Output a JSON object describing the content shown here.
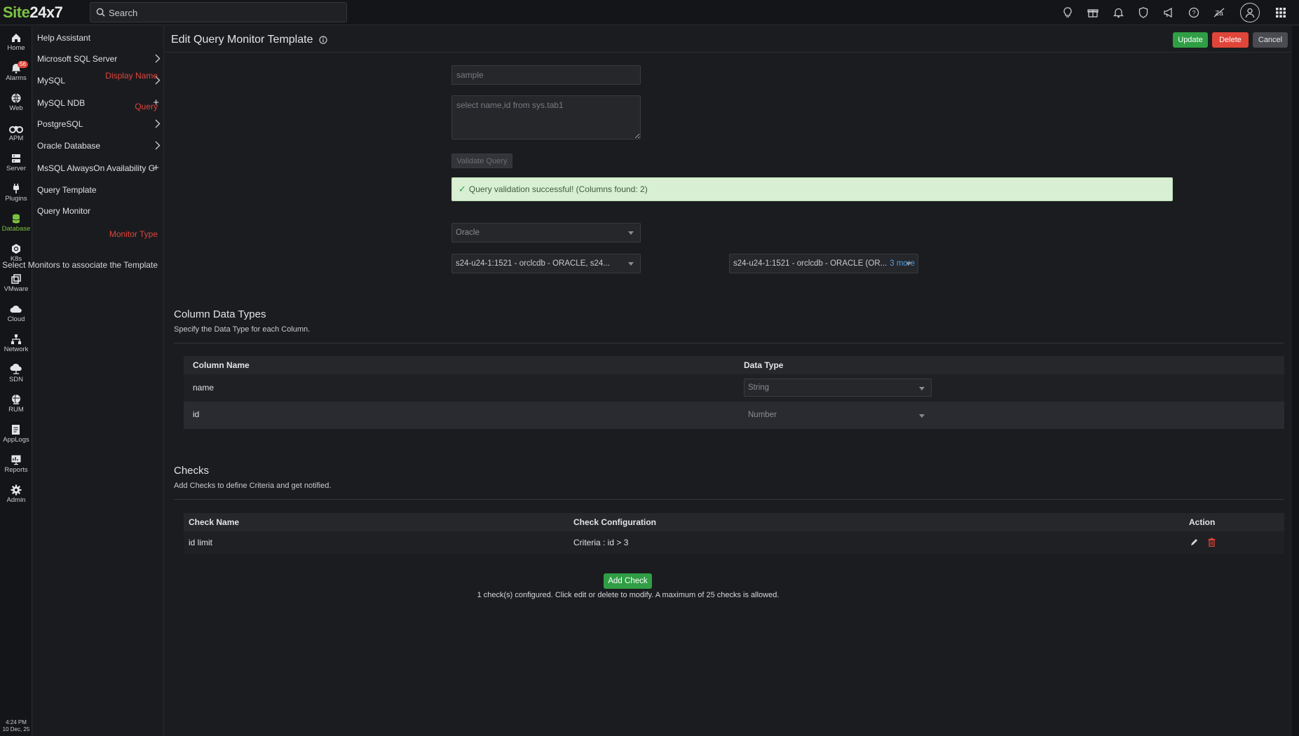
{
  "app": {
    "logo_site": "Site",
    "logo_num": "24x7",
    "search_placeholder": "Search",
    "top_icons": [
      "bulb-icon",
      "gift-icon",
      "bell-icon",
      "shield-icon",
      "megaphone-icon",
      "help-icon",
      "accessibility-icon",
      "user-avatar-icon",
      "apps-grid-icon"
    ]
  },
  "rail": {
    "items": [
      {
        "label": "Home",
        "icon": "home-icon"
      },
      {
        "label": "Alarms",
        "icon": "bell-icon",
        "badge": "56"
      },
      {
        "label": "Web",
        "icon": "globe-icon"
      },
      {
        "label": "APM",
        "icon": "binoculars-icon"
      },
      {
        "label": "Server",
        "icon": "server-icon"
      },
      {
        "label": "Plugins",
        "icon": "plug-icon"
      },
      {
        "label": "Database",
        "icon": "database-icon"
      },
      {
        "label": "K8s",
        "icon": "kubernetes-icon"
      },
      {
        "label": "VMware",
        "icon": "vmware-icon"
      },
      {
        "label": "Cloud",
        "icon": "cloud-icon"
      },
      {
        "label": "Network",
        "icon": "network-icon"
      },
      {
        "label": "SDN",
        "icon": "sdn-icon"
      },
      {
        "label": "RUM",
        "icon": "rum-icon"
      },
      {
        "label": "AppLogs",
        "icon": "applogs-icon"
      },
      {
        "label": "Reports",
        "icon": "reports-icon"
      },
      {
        "label": "Admin",
        "icon": "gear-icon"
      }
    ],
    "clock_time": "4:24 PM",
    "clock_date": "10 Dec, 25"
  },
  "subnav": {
    "items": [
      {
        "label": "Help Assistant",
        "marker": ""
      },
      {
        "label": "Microsoft SQL Server",
        "marker": "chevron"
      },
      {
        "label": "MySQL",
        "marker": "chevron"
      },
      {
        "label": "MySQL NDB",
        "marker": "plus"
      },
      {
        "label": "PostgreSQL",
        "marker": "chevron"
      },
      {
        "label": "Oracle Database",
        "marker": "chevron"
      },
      {
        "label": "MsSQL AlwaysOn Availability Group",
        "marker": "plus"
      },
      {
        "label": "Query Template",
        "marker": ""
      },
      {
        "label": "Query Monitor",
        "marker": ""
      }
    ]
  },
  "page": {
    "title": "Edit Query Monitor Template",
    "update_label": "Update",
    "delete_label": "Delete",
    "cancel_label": "Cancel"
  },
  "form": {
    "display_name_label": "Display Name",
    "display_name_placeholder": "sample",
    "query_label": "Query",
    "query_placeholder": "select name,id from sys.tab1",
    "validate_label": "Validate Query",
    "success_message": "Query validation successful! (Columns found: 2)",
    "monitor_type_label": "Monitor Type",
    "monitor_type_value": "Oracle",
    "associate_label": "Select Monitors to associate the Template",
    "associate_value_1": "s24-u24-1:1521 - orclcdb - ORACLE, s24...",
    "associate_value_2": "s24-u24-1:1521 - orclcdb - ORACLE (OR...",
    "associate_more": "3 more"
  },
  "columns_section": {
    "title": "Column Data Types",
    "description": "Specify the Data Type for each Column.",
    "headers": {
      "name": "Column Name",
      "type": "Data Type"
    },
    "rows": [
      {
        "name": "name",
        "type": "String"
      },
      {
        "name": "id",
        "type": "Number"
      }
    ]
  },
  "checks_section": {
    "title": "Checks",
    "description": "Add Checks to define Criteria and get notified.",
    "headers": {
      "name": "Check Name",
      "config": "Check Configuration",
      "action": "Action"
    },
    "rows": [
      {
        "name": "id limit",
        "config": "Criteria : id > 3"
      }
    ],
    "add_label": "Add Check",
    "note": "1 check(s) configured. Click edit or delete to modify. A maximum of 25 checks is allowed."
  },
  "colors": {
    "accent_green": "#2f9e44",
    "danger_red": "#e0453a",
    "link_blue": "#4a9fe8",
    "logo_green": "#7cc243"
  }
}
